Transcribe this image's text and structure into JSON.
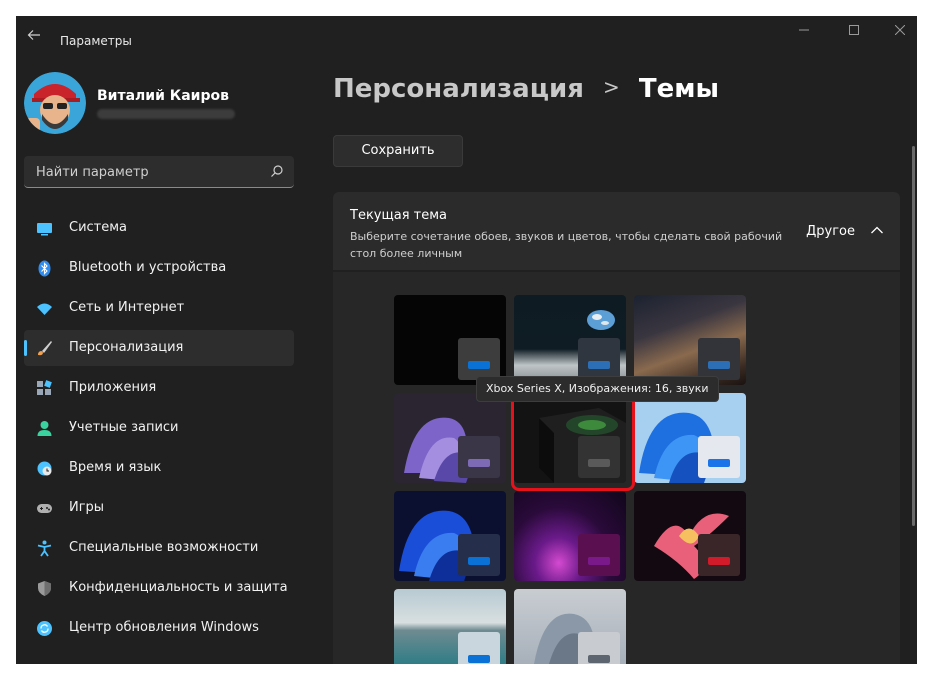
{
  "window": {
    "title": "Параметры",
    "back_icon": "arrow-left-icon",
    "controls": [
      "minimize-icon",
      "maximize-icon",
      "close-icon"
    ]
  },
  "profile": {
    "name": "Виталий Каиров"
  },
  "search": {
    "placeholder": "Найти параметр",
    "icon": "search-icon"
  },
  "sidebar": {
    "items": [
      {
        "label": "Система",
        "icon": "system-icon",
        "color": "#4cc2ff",
        "active": false
      },
      {
        "label": "Bluetooth и устройства",
        "icon": "bluetooth-icon",
        "color": "#2f8cf0",
        "active": false
      },
      {
        "label": "Сеть и Интернет",
        "icon": "wifi-icon",
        "color": "#4cc2ff",
        "active": false
      },
      {
        "label": "Персонализация",
        "icon": "brush-icon",
        "color": "#f0a050",
        "active": true
      },
      {
        "label": "Приложения",
        "icon": "apps-icon",
        "color": "#9aa7b8",
        "active": false
      },
      {
        "label": "Учетные записи",
        "icon": "account-icon",
        "color": "#3ad29f",
        "active": false
      },
      {
        "label": "Время и язык",
        "icon": "clock-globe-icon",
        "color": "#4cc2ff",
        "active": false
      },
      {
        "label": "Игры",
        "icon": "gamepad-icon",
        "color": "#b0b0b0",
        "active": false
      },
      {
        "label": "Специальные возможности",
        "icon": "accessibility-icon",
        "color": "#4cc2ff",
        "active": false
      },
      {
        "label": "Конфиденциальность и защита",
        "icon": "shield-icon",
        "color": "#9a9a9a",
        "active": false
      },
      {
        "label": "Центр обновления Windows",
        "icon": "update-icon",
        "color": "#4cc2ff",
        "active": false
      }
    ]
  },
  "breadcrumb": {
    "parent": "Персонализация",
    "separator": ">",
    "current": "Темы"
  },
  "toolbar": {
    "save_label": "Сохранить"
  },
  "current_theme": {
    "title": "Текущая тема",
    "description": "Выберите сочетание обоев, звуков и цветов, чтобы сделать свой рабочий стол более личным",
    "value": "Другое",
    "chevron": "chevron-up-icon"
  },
  "themes": [
    {
      "name": "theme-dark",
      "accent": "#0a72d6",
      "box": "#3d3d3d",
      "bg": "dark"
    },
    {
      "name": "theme-earth-moon",
      "accent": "#2c6fb7",
      "box": "#2f3640",
      "bg": "moon"
    },
    {
      "name": "theme-desert-night",
      "accent": "#2c6fb7",
      "box": "#33333a",
      "bg": "desert"
    },
    {
      "name": "theme-windows-purple",
      "accent": "#7d6bb5",
      "box": "#3a3648",
      "bg": "bloom-purple"
    },
    {
      "name": "theme-xbox-series-x",
      "accent": "#5a5a5a",
      "box": "#333333",
      "bg": "xbox"
    },
    {
      "name": "theme-windows-light",
      "accent": "#1a73e8",
      "box": "#e5e8ee",
      "bg": "bloom-light"
    },
    {
      "name": "theme-windows-dark",
      "accent": "#0a72d6",
      "box": "#252e4a",
      "bg": "bloom-dark"
    },
    {
      "name": "theme-glow",
      "accent": "#7a1a8a",
      "box": "#5a1050",
      "bg": "glow"
    },
    {
      "name": "theme-captured-motion",
      "accent": "#d11a2a",
      "box": "#3a2628",
      "bg": "flower"
    },
    {
      "name": "theme-sunrise",
      "accent": "#0a72d6",
      "box": "#c9d6de",
      "bg": "lake"
    },
    {
      "name": "theme-flow",
      "accent": "#5d6670",
      "box": "#c8ccd1",
      "bg": "flow"
    }
  ],
  "tooltip": {
    "text": "Xbox Series X, Изображения: 16, звуки"
  },
  "colors": {
    "window_bg": "#202020",
    "accent": "#4cc2ff",
    "highlight": "#e5121c"
  }
}
